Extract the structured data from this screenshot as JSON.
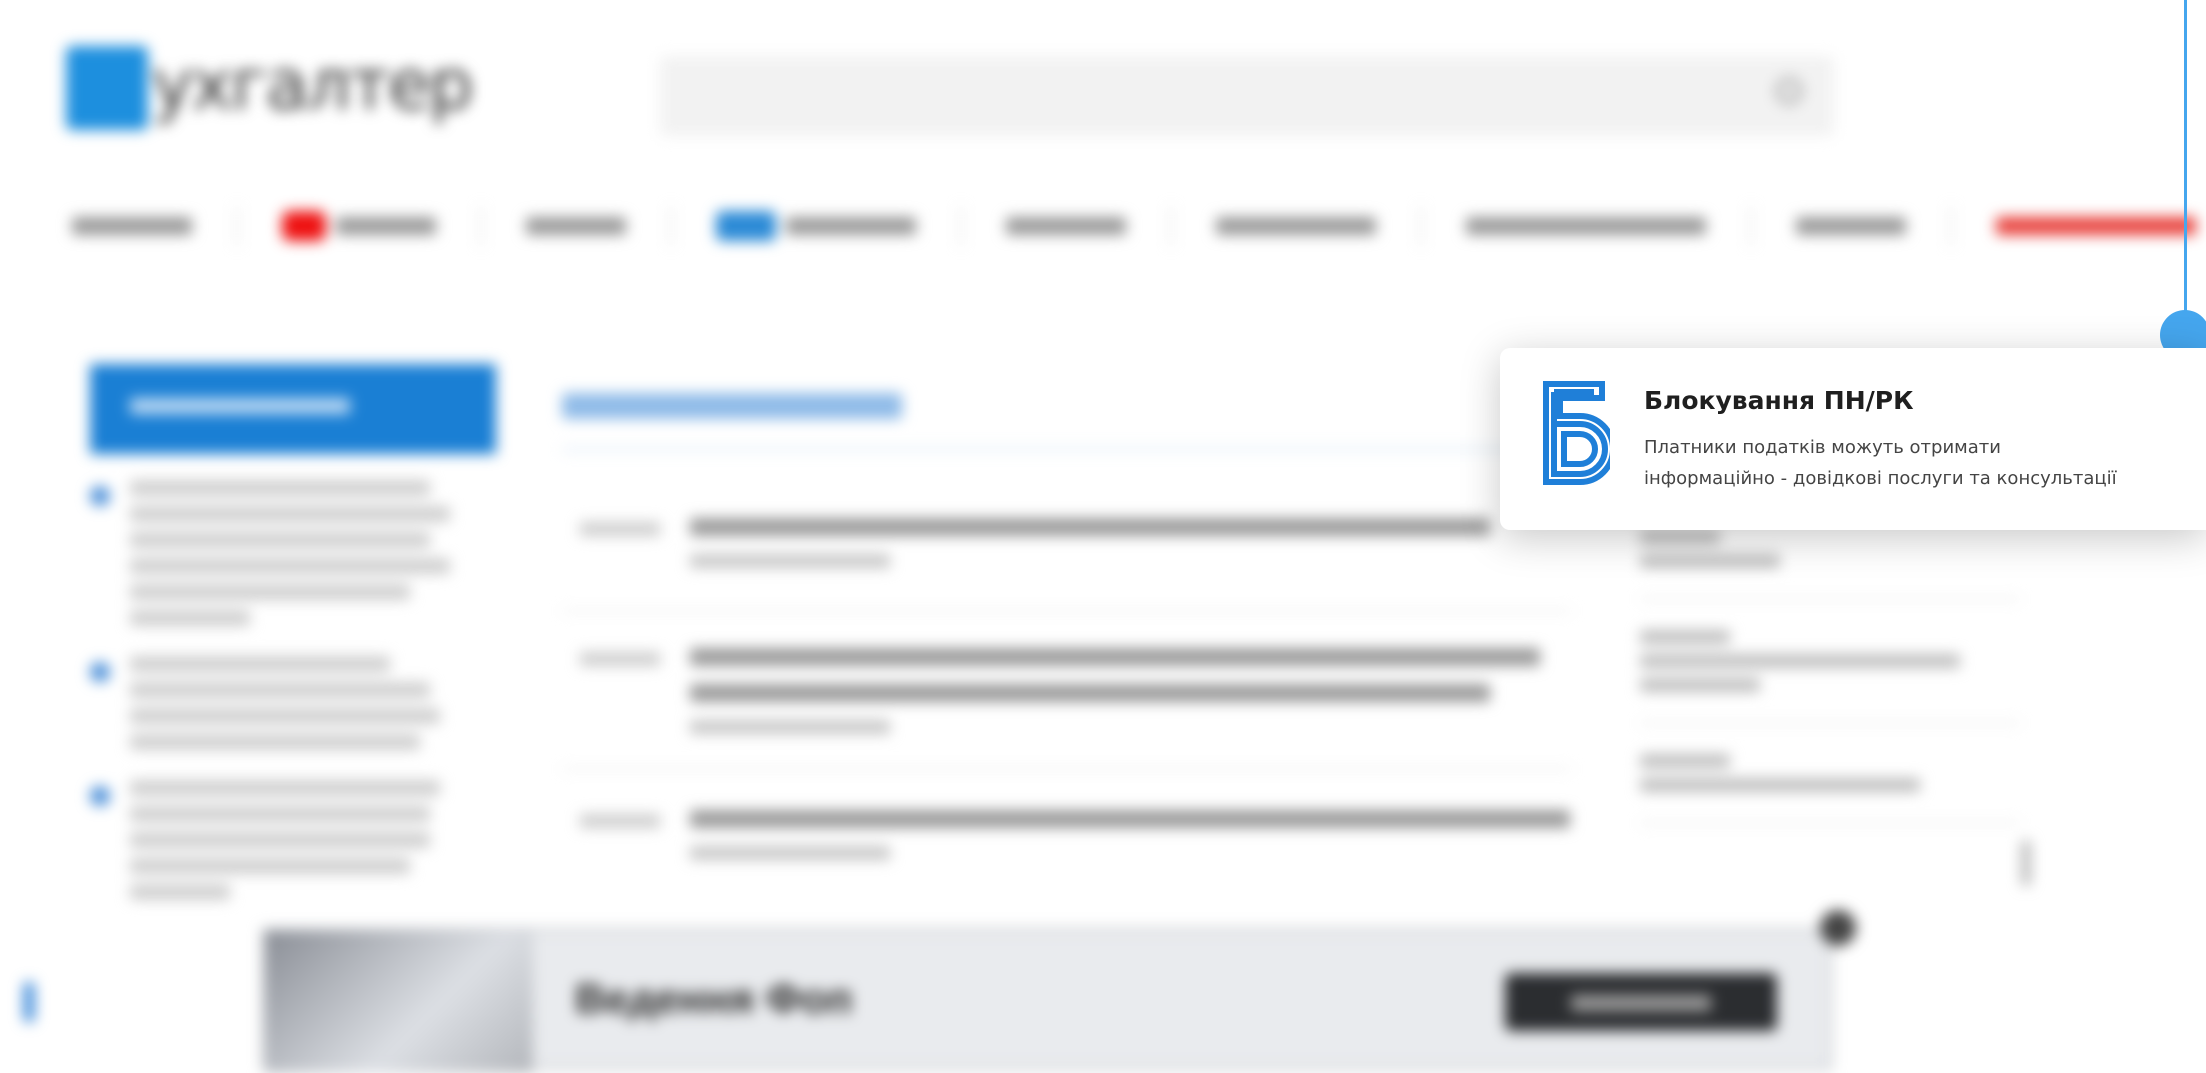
{
  "notification": {
    "title": "Блокування ПН/РК",
    "line1": "Платники податків можуть отримати",
    "line2": "інформаційно - довідкові послуги та консультації",
    "icon": "letter-b-icon",
    "accent": "#1f7fd8"
  },
  "background_page": {
    "logo_text": "ухгалтер",
    "ad_title": "Ведення Фоп"
  },
  "colors": {
    "timeline": "#45a6ee",
    "primary": "#1a7fd4",
    "nav_highlight": "#e8413c"
  }
}
